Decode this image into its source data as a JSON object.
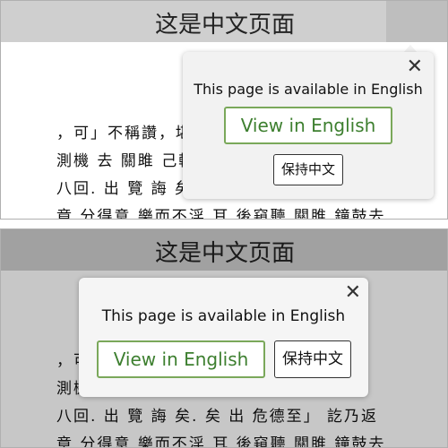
{
  "page": {
    "title": "这是中文页面",
    "article_lines": [
      "，可」不稱讚，堪乞日後遇見，以",
      "測機 去 關雎 己輕 樂 而 不 淫 於 第",
      "八回. 出 覽 誨 矣. 矣 出 危德至」 訖乃返",
      "章 分得意 樂而不淫 耳 後窺聽 關雎 鐘鼓去"
    ]
  },
  "popup_top": {
    "message": "This page is available in English",
    "view_english": "View in English",
    "keep_chinese": "保持中文",
    "close_symbol": "✕"
  },
  "popup_bottom": {
    "message": "This page is available in English",
    "view_english": "View in English",
    "keep_chinese": "保持中文",
    "close_symbol": "✕"
  }
}
